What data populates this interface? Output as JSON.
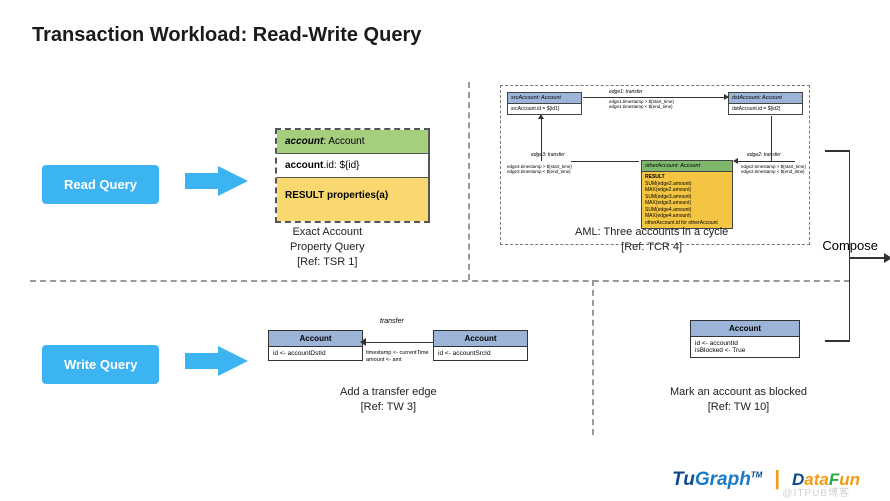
{
  "title": "Transaction Workload: Read-Write Query",
  "buttons": {
    "read": "Read Query",
    "write": "Write Query"
  },
  "exact": {
    "row1_label": "account",
    "row1_type": ": Account",
    "row2_label": "account",
    "row2_rest": ".id: ${id}",
    "row3": "RESULT properties(a)",
    "caption": "Exact Account\nProperty Query\n[Ref: TSR 1]"
  },
  "aml": {
    "src_h": "srcAccount: Account",
    "src_c": "srcAccount.id = ${id1}",
    "dst_h": "dstAccount: Account",
    "dst_c": "dstAccount.id = ${id2}",
    "other_h": "otherAccount: Account",
    "edge1_lbl": "edge1: transfer",
    "edge1_sub": "edge1.timestamp > ${start_time}\nedge1.timestamp < ${end_time}",
    "edge2_lbl": "edge2: transfer",
    "edge2_sub": "edge2.timestamp > ${start_time}\nedge2.timestamp < ${end_time}",
    "edge3_lbl": "edge3: transfer",
    "edge3_sub": "edge3.timestamp > ${start_time}\nedge3.timestamp < ${end_time}",
    "result_h": "RESULT",
    "result_lines": "SUM(edge2.amount)\nMAX(edge2.amount)\nSUM(edge3.amount)\nMAX(edge3.amount)\nSUM(edge4.amount)\nMAX(edge4.amount)\notherAccount.id for otherAccount",
    "caption": "AML: Three accounts in a cycle\n[Ref: TCR 4]"
  },
  "transfer": {
    "h": "Account",
    "left_c": "id <- accountDstId",
    "right_c": "id <- accountSrcId",
    "edge_lbl": "transfer",
    "edge_sub": "timestamp <- currentTime\namount <- amt",
    "caption": "Add a transfer edge\n[Ref: TW 3]"
  },
  "mark": {
    "h": "Account",
    "c": "id <- accountId\nisBlocked <- True",
    "caption": "Mark an account as blocked\n[Ref: TW 10]"
  },
  "compose": "Compose",
  "footer": {
    "tugraph_tu": "Tu",
    "tugraph_gr": "Graph",
    "tm": "TM",
    "sep": "|",
    "df_d": "D",
    "df_ata": "ata",
    "df_f": "F",
    "df_un": "un"
  },
  "watermark": "@ITPUB博客"
}
